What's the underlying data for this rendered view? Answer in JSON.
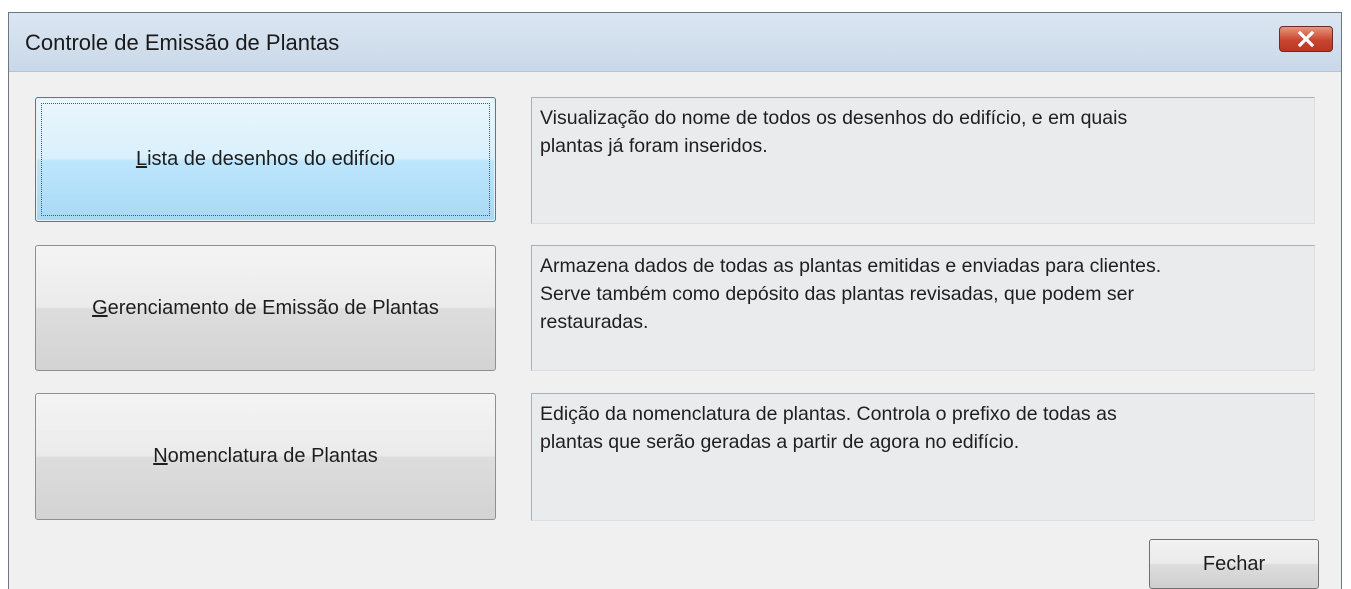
{
  "window": {
    "title": "Controle de Emissão de Plantas",
    "close_icon": "close-x-icon"
  },
  "options": [
    {
      "accel": "L",
      "label_rest": "ista de desenhos do edifício",
      "description": "Visualização do nome de todos os desenhos do edifício, e em quais\nplantas já foram inseridos."
    },
    {
      "accel": "G",
      "label_rest": "erenciamento de Emissão de Plantas",
      "description": "Armazena dados de todas as plantas emitidas e enviadas para clientes.\nServe também como depósito das plantas revisadas, que podem ser\nrestauradas."
    },
    {
      "accel": "N",
      "label_rest": "omenclatura de Plantas",
      "description": "Edição da nomenclatura de plantas. Controla o prefixo de todas as\nplantas que serão geradas a partir de agora no edifício."
    }
  ],
  "footer": {
    "close_label": "Fechar"
  },
  "colors": {
    "focused_button": "#bee6fd",
    "close_button": "#c9452f"
  }
}
